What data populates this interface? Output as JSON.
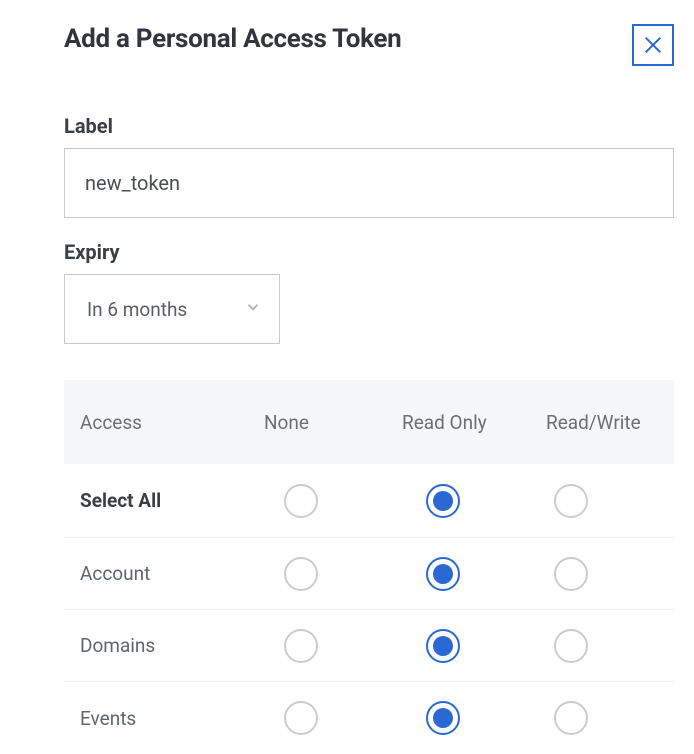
{
  "modal": {
    "title": "Add a Personal Access Token"
  },
  "form": {
    "label_field": {
      "label": "Label",
      "value": "new_token"
    },
    "expiry_field": {
      "label": "Expiry",
      "value": "In 6 months"
    }
  },
  "table": {
    "headers": {
      "access": "Access",
      "none": "None",
      "readonly": "Read Only",
      "readwrite": "Read/Write"
    },
    "rows": {
      "select_all": {
        "label": "Select All",
        "selected": "readonly"
      },
      "account": {
        "label": "Account",
        "selected": "readonly"
      },
      "domains": {
        "label": "Domains",
        "selected": "readonly"
      },
      "events": {
        "label": "Events",
        "selected": "readonly"
      }
    }
  }
}
